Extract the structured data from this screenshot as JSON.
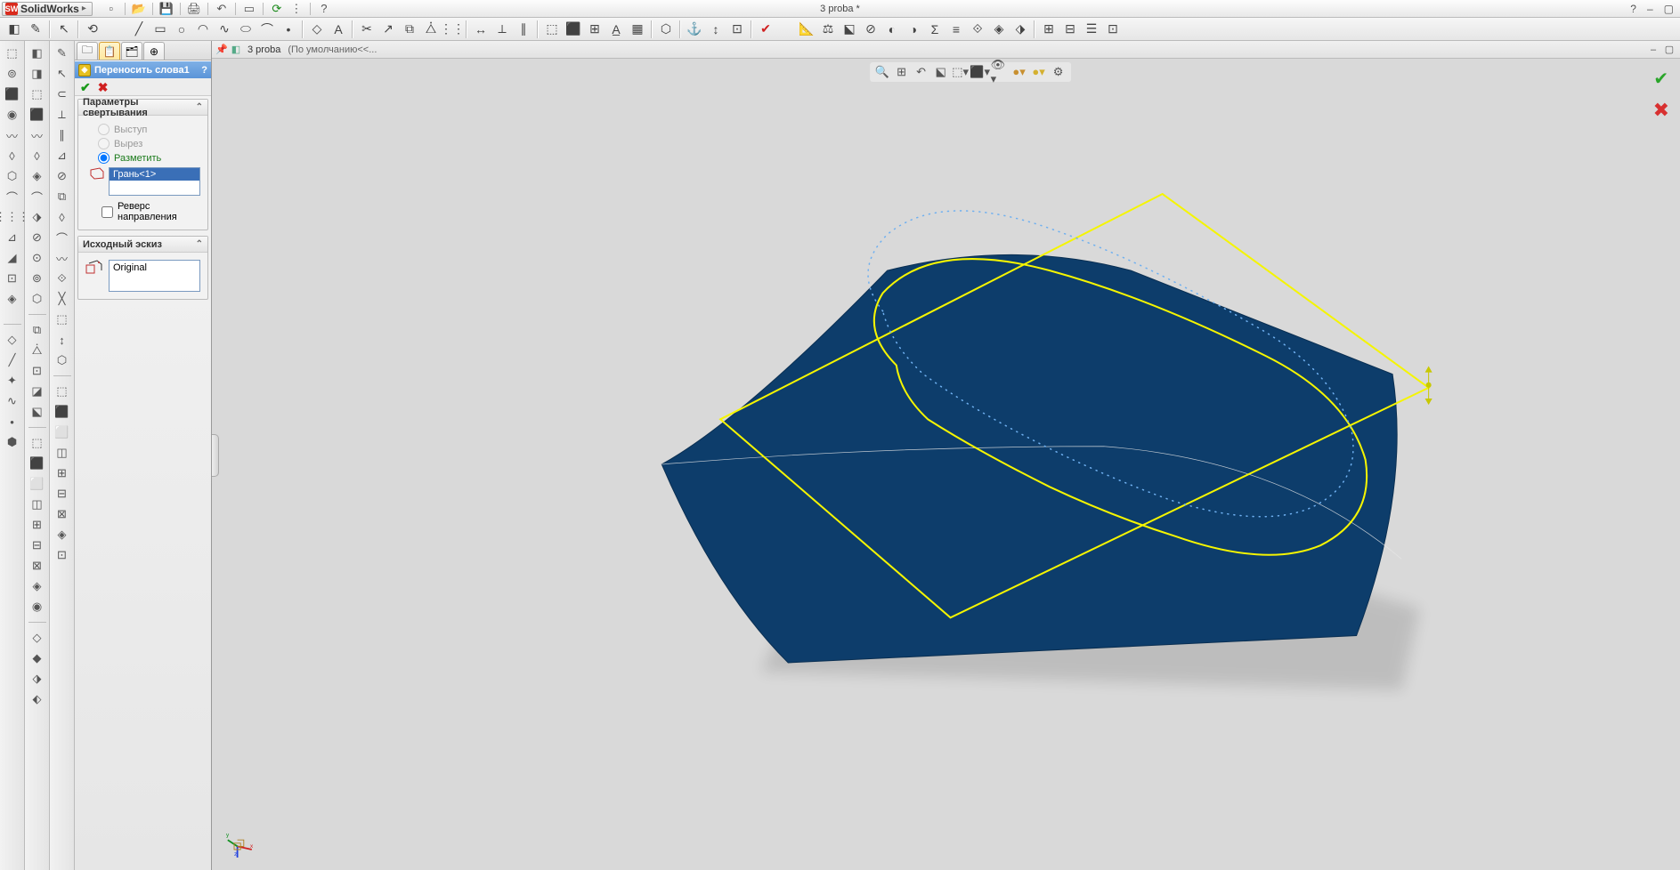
{
  "app": {
    "logo": "SolidWorks",
    "documentTitle": "3 proba *"
  },
  "breadcrumb": {
    "partName": "3 proba",
    "config": "(По умолчанию<<..."
  },
  "propertyManager": {
    "title": "Переносить слова1",
    "section1": {
      "title": "Параметры свертывания",
      "opt_extrude": "Выступ",
      "opt_cut": "Вырез",
      "opt_split": "Разметить",
      "selected_face": "Грань<1>",
      "reverse": "Реверс направления"
    },
    "section2": {
      "title": "Исходный эскиз",
      "value": "Original"
    }
  }
}
